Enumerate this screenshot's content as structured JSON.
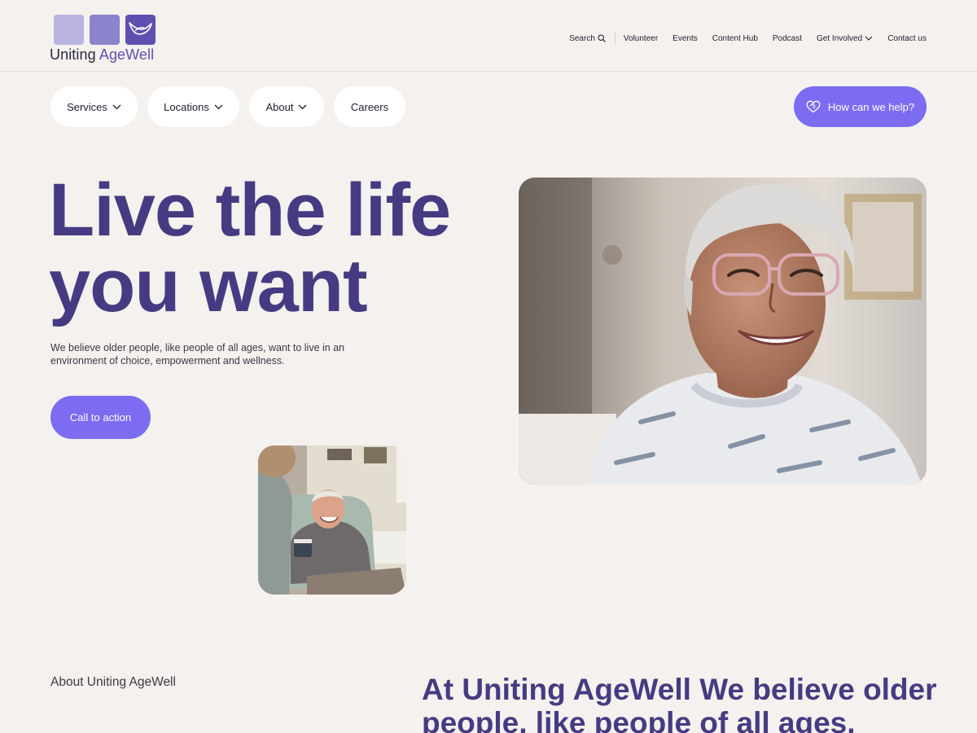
{
  "brand": {
    "name_part1": "Uniting",
    "name_part2": "AgeWell",
    "colors": {
      "accent": "#7b6cf1",
      "heading": "#463b82",
      "background": "#f4f1ee",
      "tile_light": "#b9b5e0",
      "tile_mid": "#8a84cc",
      "tile_dark": "#5e4fb0"
    }
  },
  "utility_nav": {
    "search_label": "Search",
    "search_icon": "search-icon",
    "items": [
      "Volunteer",
      "Events",
      "Content Hub",
      "Podcast",
      "Get Involved",
      "Contact us"
    ]
  },
  "main_nav": {
    "items": [
      {
        "label": "Services",
        "has_dropdown": true
      },
      {
        "label": "Locations",
        "has_dropdown": true
      },
      {
        "label": "About",
        "has_dropdown": true
      },
      {
        "label": "Careers",
        "has_dropdown": false
      }
    ],
    "help_button": {
      "label": "How can we help?",
      "icon": "heart-handshake-icon"
    }
  },
  "hero": {
    "title_line1": "Live the life",
    "title_line2": "you want",
    "body": "We believe older people, like people of all ages, want to live in an environment of choice, empowerment and wellness.",
    "cta_label": "Call to action"
  },
  "about": {
    "label": "About Uniting AgeWell",
    "headline": "At Uniting AgeWell We believe older people, like people of all ages,"
  }
}
